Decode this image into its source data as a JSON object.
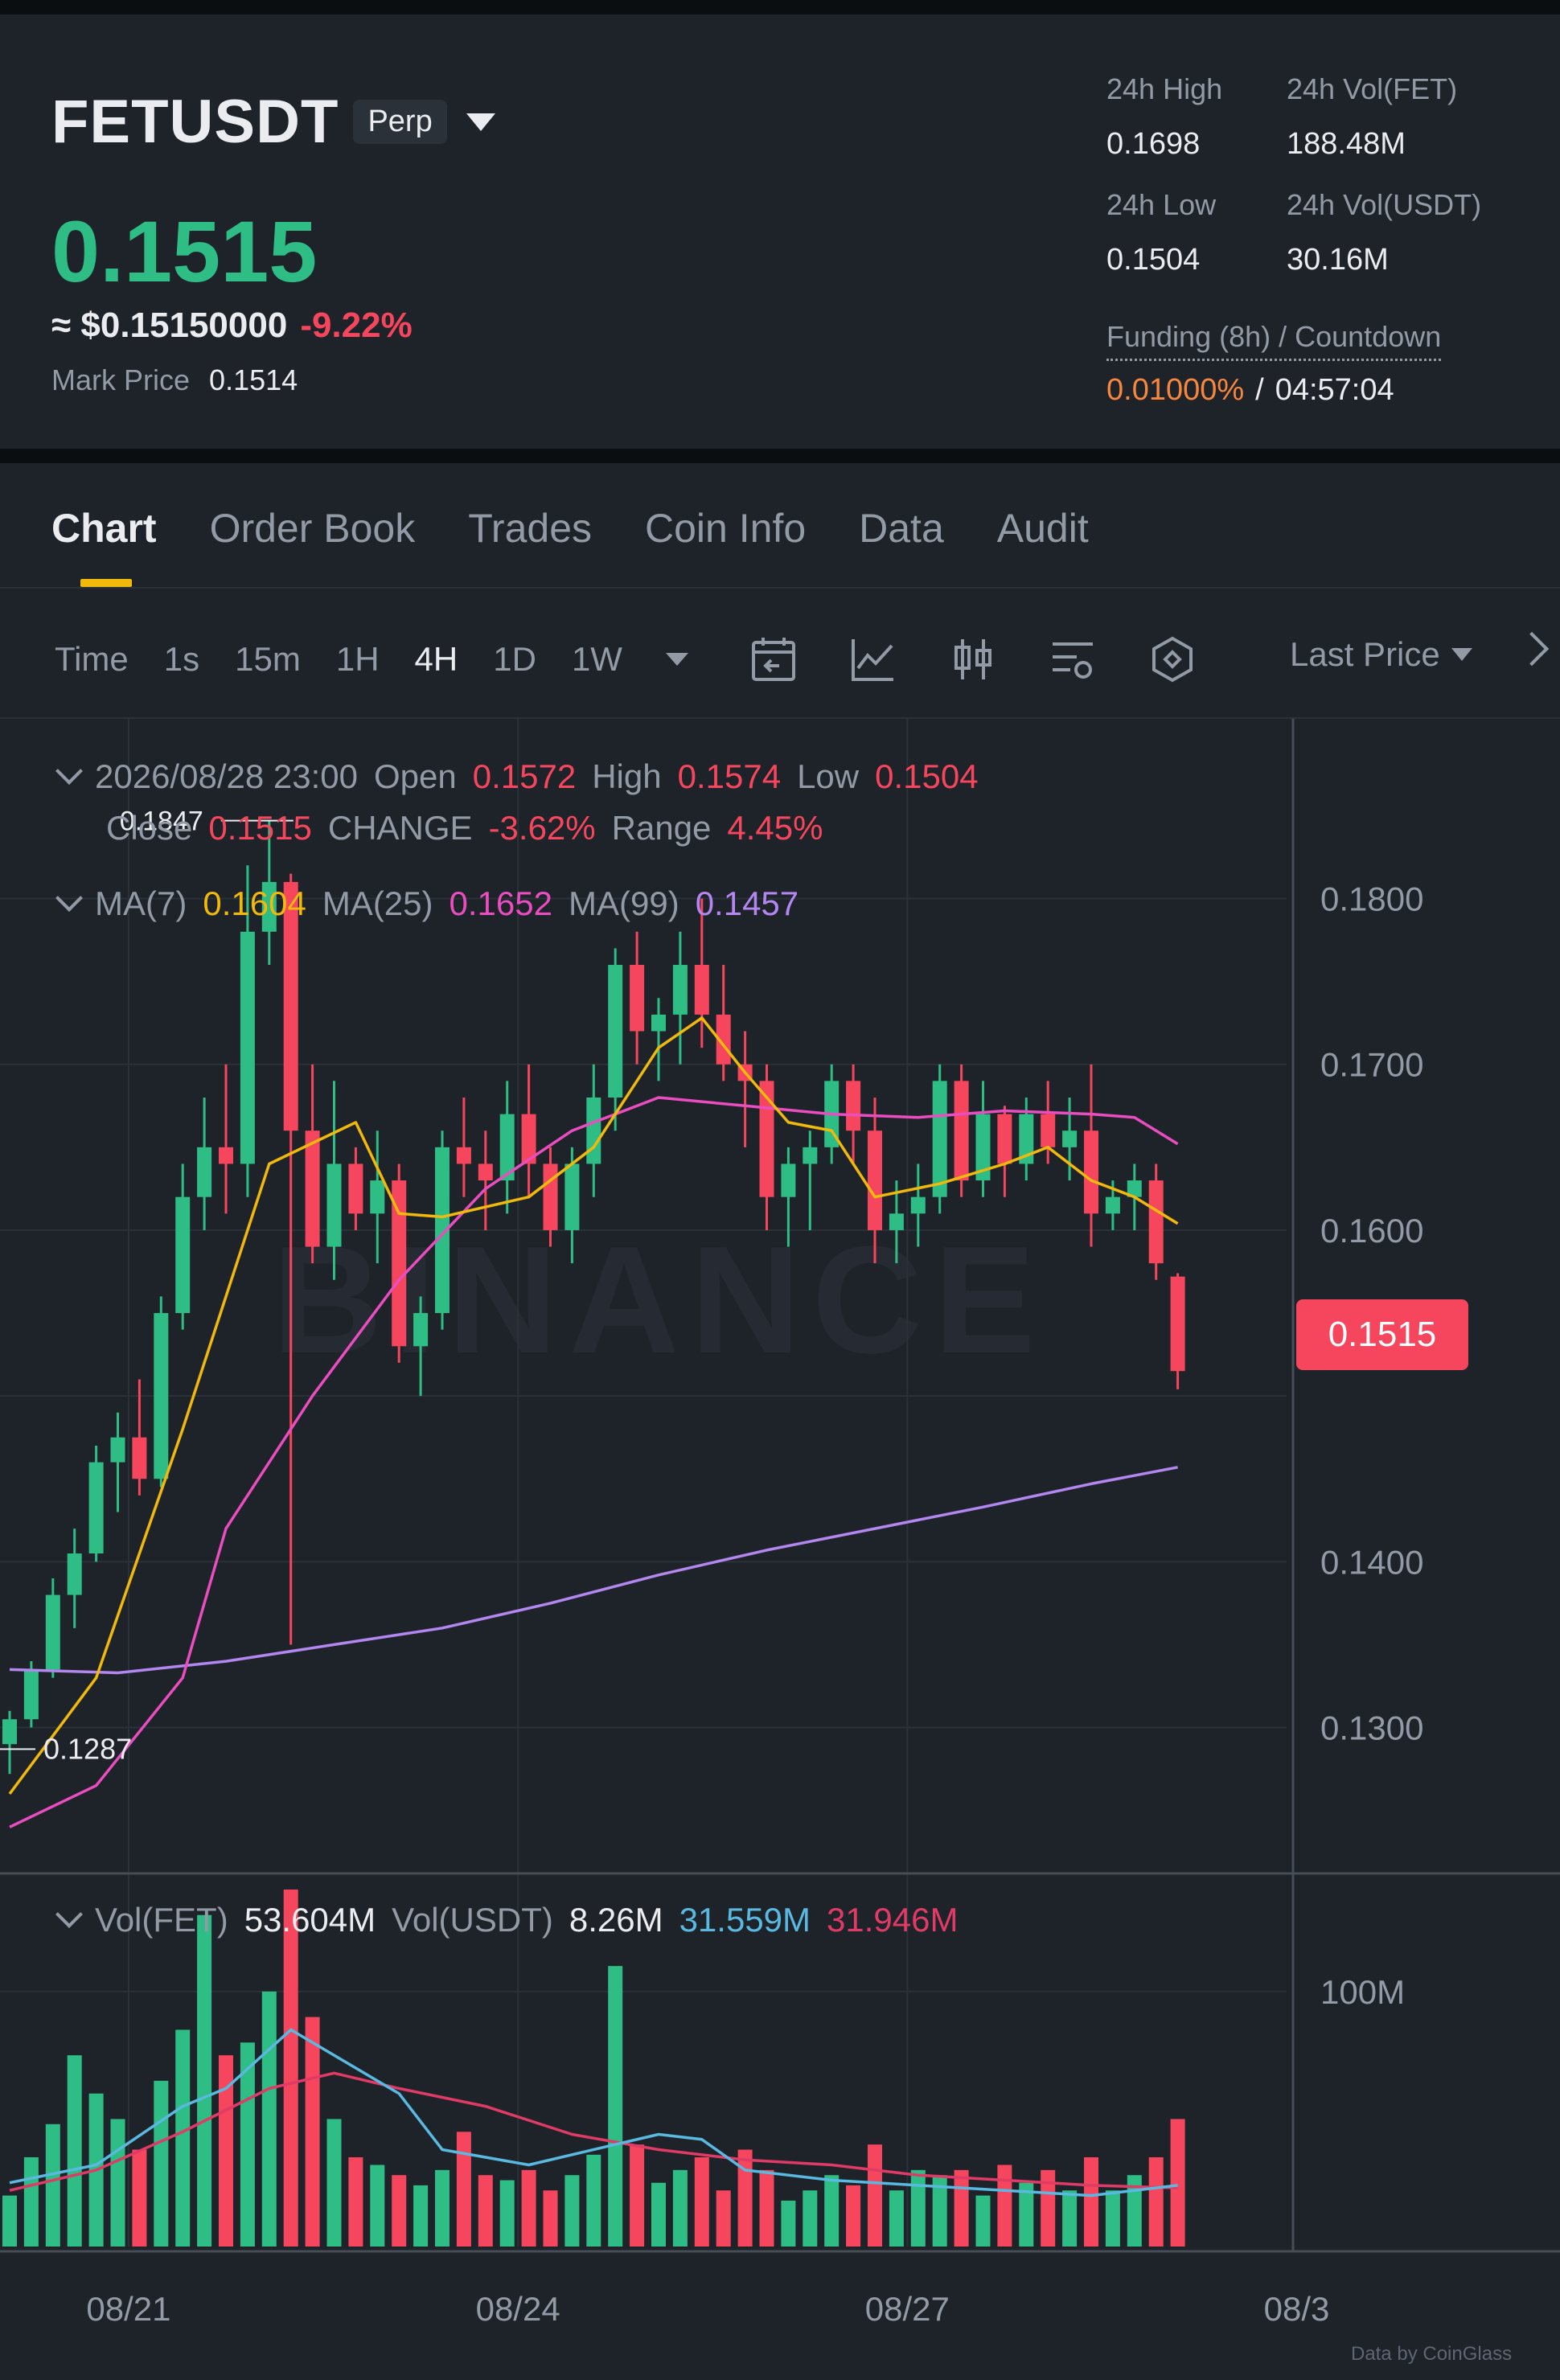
{
  "header": {
    "symbol": "FETUSDT",
    "contract_type": "Perp",
    "last_price": "0.1515",
    "usd_price": "≈ $0.15150000",
    "change_pct": "-9.22%",
    "mark_price_label": "Mark Price",
    "mark_price": "0.1514",
    "stats": {
      "high_label": "24h High",
      "high": "0.1698",
      "vol_fet_label": "24h Vol(FET)",
      "vol_fet": "188.48M",
      "low_label": "24h Low",
      "low": "0.1504",
      "vol_usdt_label": "24h Vol(USDT)",
      "vol_usdt": "30.16M"
    },
    "funding": {
      "label": "Funding (8h) / Countdown",
      "rate": "0.01000%",
      "separator": "/",
      "countdown": "04:57:04"
    }
  },
  "tabs": [
    "Chart",
    "Order Book",
    "Trades",
    "Coin Info",
    "Data",
    "Audit"
  ],
  "toolbar": {
    "time_label": "Time",
    "intervals": [
      "1s",
      "15m",
      "1H",
      "4H",
      "1D",
      "1W"
    ],
    "active_interval": "4H",
    "price_source": "Last Price",
    "icons": [
      "calendar-icon",
      "indicator-icon",
      "candle-type-icon",
      "settings-icon",
      "depth-icon"
    ]
  },
  "ohlc": {
    "date": "2026/08/28 23:00",
    "open_label": "Open",
    "open": "0.1572",
    "high_label": "High",
    "high": "0.1574",
    "low_label": "Low",
    "low": "0.1504",
    "close_label": "Close",
    "close": "0.1515",
    "change_label": "CHANGE",
    "change": "-3.62%",
    "range_label": "Range",
    "range": "4.45%"
  },
  "ma": {
    "ma7_label": "MA(7)",
    "ma7": "0.1604",
    "ma25_label": "MA(25)",
    "ma25": "0.1652",
    "ma99_label": "MA(99)",
    "ma99": "0.1457"
  },
  "vol": {
    "vol_fet_label": "Vol(FET)",
    "vol_fet": "53.604M",
    "vol_usdt_label": "Vol(USDT)",
    "vol_usdt": "8.26M",
    "ma5": "31.559M",
    "ma10": "31.946M"
  },
  "price_tag": "0.1515",
  "chart_annotations": {
    "max": "0.1847",
    "min": "0.1287"
  },
  "watermark": "BINANCE",
  "footer_credit": "Data by CoinGlass",
  "colors": {
    "up": "#2ebd85",
    "down": "#f6465d",
    "ma7": "#f0b90b",
    "ma25": "#e94dc0",
    "ma99": "#b386f0",
    "vol_ma5": "#59b9e0",
    "vol_ma10": "#e03a66",
    "accent": "#f0b90b"
  },
  "chart_data": {
    "type": "candlestick",
    "interval": "4H",
    "price_axis": {
      "ticks": [
        "0.1800",
        "0.1700",
        "0.1600",
        "0.1400",
        "0.1300"
      ],
      "range": [
        0.1212,
        0.1857
      ]
    },
    "volume_axis": {
      "ticks": [
        "100M"
      ],
      "max": 140
    },
    "x_labels": [
      {
        "label": "08/21",
        "index": 5.5
      },
      {
        "label": "08/24",
        "index": 23.5
      },
      {
        "label": "08/27",
        "index": 41.5
      },
      {
        "label": "08/3",
        "index": 59.5
      }
    ],
    "candles": [
      [
        0.129,
        0.131,
        0.1272,
        0.1305,
        20
      ],
      [
        0.1305,
        0.134,
        0.13,
        0.1335,
        35
      ],
      [
        0.1335,
        0.139,
        0.133,
        0.138,
        48
      ],
      [
        0.138,
        0.142,
        0.136,
        0.1405,
        75
      ],
      [
        0.1405,
        0.147,
        0.14,
        0.146,
        60
      ],
      [
        0.146,
        0.149,
        0.143,
        0.1475,
        50
      ],
      [
        0.1475,
        0.151,
        0.144,
        0.145,
        38
      ],
      [
        0.145,
        0.156,
        0.1445,
        0.155,
        65
      ],
      [
        0.155,
        0.164,
        0.154,
        0.162,
        85
      ],
      [
        0.162,
        0.168,
        0.16,
        0.165,
        130
      ],
      [
        0.165,
        0.17,
        0.161,
        0.164,
        75
      ],
      [
        0.164,
        0.182,
        0.162,
        0.178,
        80
      ],
      [
        0.178,
        0.1847,
        0.176,
        0.181,
        100
      ],
      [
        0.181,
        0.1815,
        0.135,
        0.166,
        140
      ],
      [
        0.166,
        0.17,
        0.158,
        0.159,
        90
      ],
      [
        0.159,
        0.169,
        0.157,
        0.164,
        50
      ],
      [
        0.164,
        0.165,
        0.16,
        0.161,
        35
      ],
      [
        0.161,
        0.166,
        0.158,
        0.163,
        32
      ],
      [
        0.163,
        0.164,
        0.152,
        0.153,
        28
      ],
      [
        0.153,
        0.156,
        0.15,
        0.155,
        24
      ],
      [
        0.155,
        0.166,
        0.154,
        0.165,
        30
      ],
      [
        0.165,
        0.168,
        0.162,
        0.164,
        45
      ],
      [
        0.164,
        0.166,
        0.16,
        0.163,
        28
      ],
      [
        0.163,
        0.169,
        0.161,
        0.167,
        26
      ],
      [
        0.167,
        0.17,
        0.162,
        0.164,
        30
      ],
      [
        0.164,
        0.165,
        0.159,
        0.16,
        22
      ],
      [
        0.16,
        0.165,
        0.158,
        0.164,
        28
      ],
      [
        0.164,
        0.17,
        0.162,
        0.168,
        36
      ],
      [
        0.168,
        0.177,
        0.166,
        0.176,
        110
      ],
      [
        0.176,
        0.178,
        0.17,
        0.172,
        40
      ],
      [
        0.172,
        0.174,
        0.169,
        0.173,
        25
      ],
      [
        0.173,
        0.178,
        0.17,
        0.176,
        30
      ],
      [
        0.176,
        0.18,
        0.171,
        0.173,
        35
      ],
      [
        0.173,
        0.176,
        0.169,
        0.17,
        22
      ],
      [
        0.17,
        0.172,
        0.165,
        0.169,
        38
      ],
      [
        0.169,
        0.17,
        0.16,
        0.162,
        30
      ],
      [
        0.162,
        0.165,
        0.159,
        0.164,
        18
      ],
      [
        0.164,
        0.166,
        0.16,
        0.165,
        22
      ],
      [
        0.165,
        0.17,
        0.164,
        0.169,
        28
      ],
      [
        0.169,
        0.17,
        0.164,
        0.166,
        24
      ],
      [
        0.166,
        0.168,
        0.158,
        0.16,
        40
      ],
      [
        0.16,
        0.163,
        0.158,
        0.161,
        22
      ],
      [
        0.161,
        0.164,
        0.159,
        0.162,
        30
      ],
      [
        0.162,
        0.17,
        0.161,
        0.169,
        28
      ],
      [
        0.169,
        0.17,
        0.162,
        0.163,
        30
      ],
      [
        0.163,
        0.169,
        0.162,
        0.167,
        20
      ],
      [
        0.167,
        0.1675,
        0.162,
        0.164,
        32
      ],
      [
        0.164,
        0.168,
        0.163,
        0.167,
        25
      ],
      [
        0.167,
        0.169,
        0.164,
        0.165,
        30
      ],
      [
        0.165,
        0.168,
        0.163,
        0.166,
        22
      ],
      [
        0.166,
        0.17,
        0.159,
        0.161,
        35
      ],
      [
        0.161,
        0.163,
        0.16,
        0.162,
        22
      ],
      [
        0.162,
        0.164,
        0.16,
        0.163,
        28
      ],
      [
        0.163,
        0.164,
        0.157,
        0.158,
        35
      ],
      [
        0.1572,
        0.1574,
        0.1504,
        0.1515,
        50
      ]
    ],
    "ma7": [
      [
        0,
        0.126
      ],
      [
        4,
        0.133
      ],
      [
        8,
        0.148
      ],
      [
        12,
        0.164
      ],
      [
        16,
        0.1665
      ],
      [
        18,
        0.161
      ],
      [
        20,
        0.1608
      ],
      [
        24,
        0.162
      ],
      [
        27,
        0.165
      ],
      [
        30,
        0.171
      ],
      [
        32,
        0.1728
      ],
      [
        34,
        0.1695
      ],
      [
        36,
        0.1665
      ],
      [
        38,
        0.166
      ],
      [
        40,
        0.162
      ],
      [
        43,
        0.1628
      ],
      [
        46,
        0.164
      ],
      [
        48,
        0.165
      ],
      [
        50,
        0.163
      ],
      [
        52,
        0.162
      ],
      [
        54,
        0.1604
      ]
    ],
    "ma25": [
      [
        0,
        0.124
      ],
      [
        4,
        0.1265
      ],
      [
        8,
        0.133
      ],
      [
        10,
        0.142
      ],
      [
        14,
        0.15
      ],
      [
        18,
        0.157
      ],
      [
        22,
        0.1625
      ],
      [
        26,
        0.166
      ],
      [
        30,
        0.168
      ],
      [
        34,
        0.1675
      ],
      [
        38,
        0.167
      ],
      [
        42,
        0.1668
      ],
      [
        46,
        0.1672
      ],
      [
        50,
        0.167
      ],
      [
        52,
        0.1668
      ],
      [
        54,
        0.1652
      ]
    ],
    "ma99": [
      [
        0,
        0.1335
      ],
      [
        5,
        0.1333
      ],
      [
        10,
        0.134
      ],
      [
        15,
        0.135
      ],
      [
        20,
        0.136
      ],
      [
        25,
        0.1375
      ],
      [
        30,
        0.1392
      ],
      [
        35,
        0.1407
      ],
      [
        40,
        0.142
      ],
      [
        45,
        0.1433
      ],
      [
        50,
        0.1447
      ],
      [
        54,
        0.1457
      ]
    ],
    "vol_ma5": [
      [
        0,
        25
      ],
      [
        4,
        32
      ],
      [
        8,
        55
      ],
      [
        10,
        62
      ],
      [
        13,
        85
      ],
      [
        15,
        75
      ],
      [
        18,
        60
      ],
      [
        20,
        38
      ],
      [
        24,
        32
      ],
      [
        28,
        40
      ],
      [
        30,
        44
      ],
      [
        32,
        42
      ],
      [
        34,
        30
      ],
      [
        38,
        26
      ],
      [
        42,
        24
      ],
      [
        46,
        22
      ],
      [
        50,
        20
      ],
      [
        54,
        24
      ]
    ],
    "vol_ma10": [
      [
        0,
        22
      ],
      [
        4,
        30
      ],
      [
        8,
        45
      ],
      [
        12,
        62
      ],
      [
        15,
        68
      ],
      [
        18,
        62
      ],
      [
        22,
        55
      ],
      [
        26,
        44
      ],
      [
        30,
        38
      ],
      [
        34,
        34
      ],
      [
        38,
        32
      ],
      [
        42,
        28
      ],
      [
        46,
        26
      ],
      [
        50,
        24
      ],
      [
        54,
        23
      ]
    ]
  }
}
